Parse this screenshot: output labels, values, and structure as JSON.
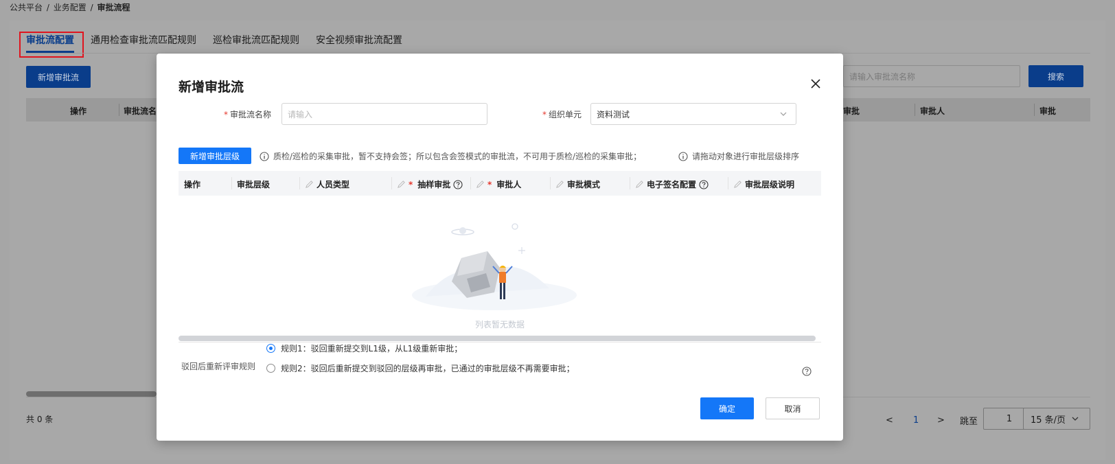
{
  "breadcrumb": [
    "公共平台",
    "/",
    "业务配置",
    "/",
    "审批流程"
  ],
  "tabs": [
    "审批流配置",
    "通用检查审批流匹配规则",
    "巡检审批流匹配规则",
    "安全视频审批流配置"
  ],
  "toolbar": {
    "add_label": "新增审批流",
    "search_placeholder": "请输入审批流名称",
    "search_label": "搜索"
  },
  "bg_table": {
    "columns": [
      "操作",
      "审批流名",
      "审批",
      "审批人",
      "审批"
    ]
  },
  "footer": {
    "total": "共 0 条",
    "prev": "<",
    "current_page": "1",
    "next": ">",
    "jump_label": "跳至",
    "jump_value": "1",
    "page_size": "15 条/页"
  },
  "modal": {
    "title": "新增审批流",
    "name_label": "审批流名称",
    "name_placeholder": "请输入",
    "org_label": "组织单元",
    "org_value": "资料测试",
    "add_level_label": "新增审批层级",
    "note_left": "质检/巡检的采集审批，暂不支持会签；所以包含会签模式的审批流，不可用于质检/巡检的采集审批；",
    "note_right": "请拖动对象进行审批层级排序",
    "columns": {
      "op": "操作",
      "level": "审批层级",
      "person_type": "人员类型",
      "sampling": "抽样审批",
      "approver": "审批人",
      "mode": "审批模式",
      "esign": "电子签名配置",
      "desc": "审批层级说明"
    },
    "empty_text": "列表暂无数据",
    "rule_label": "驳回后重新评审规则",
    "rule1": "规则1：驳回重新提交到L1级，从L1级重新审批；",
    "rule2": "规则2：驳回后重新提交到驳回的层级再审批，已通过的审批层级不再需要审批；",
    "ok_label": "确定",
    "cancel_label": "取消"
  },
  "colors": {
    "primary": "#1477f8",
    "required": "#e5382e",
    "highlight_box": "#e0141e"
  }
}
